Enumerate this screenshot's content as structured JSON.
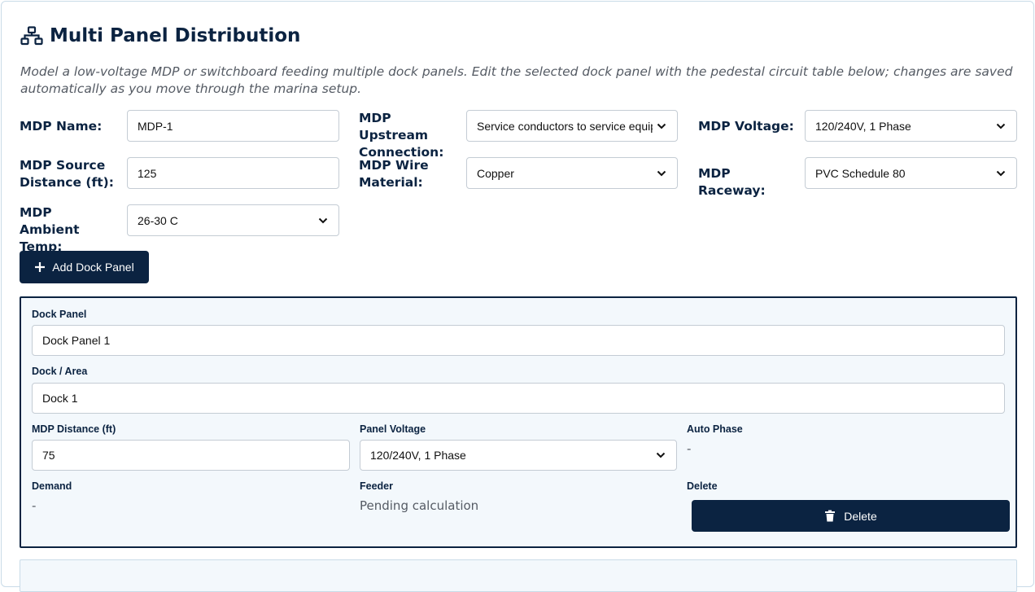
{
  "header": {
    "title": "Multi Panel Distribution",
    "icon": "network-icon",
    "description": "Model a low-voltage MDP or switchboard feeding multiple dock panels. Edit the selected dock panel with the pedestal circuit table below; changes are saved automatically as you move through the marina setup."
  },
  "mdp": {
    "name_label": "MDP Name:",
    "name_value": "MDP-1",
    "upstream_label": "MDP Upstream Connection:",
    "upstream_value": "Service conductors to service equipment",
    "voltage_label": "MDP Voltage:",
    "voltage_value": "120/240V, 1 Phase",
    "source_distance_label": "MDP Source Distance (ft):",
    "source_distance_value": "125",
    "wire_material_label": "MDP Wire Material:",
    "wire_material_value": "Copper",
    "raceway_label": "MDP Raceway:",
    "raceway_value": "PVC Schedule 80",
    "ambient_label": "MDP Ambient Temp:",
    "ambient_value": "26-30 C"
  },
  "actions": {
    "add_dock_panel": "Add Dock Panel"
  },
  "dock_panel": {
    "panel_label": "Dock Panel",
    "panel_value": "Dock Panel 1",
    "area_label": "Dock / Area",
    "area_value": "Dock 1",
    "distance_label": "MDP Distance (ft)",
    "distance_value": "75",
    "voltage_label": "Panel Voltage",
    "voltage_value": "120/240V, 1 Phase",
    "auto_phase_label": "Auto Phase",
    "auto_phase_value": "-",
    "demand_label": "Demand",
    "demand_value": "-",
    "feeder_label": "Feeder",
    "feeder_value": "Pending calculation",
    "delete_label": "Delete",
    "delete_button": "Delete"
  },
  "colors": {
    "navy": "#0b2341",
    "panel_bg": "#f3f8fc",
    "muted_text": "#555b64"
  }
}
